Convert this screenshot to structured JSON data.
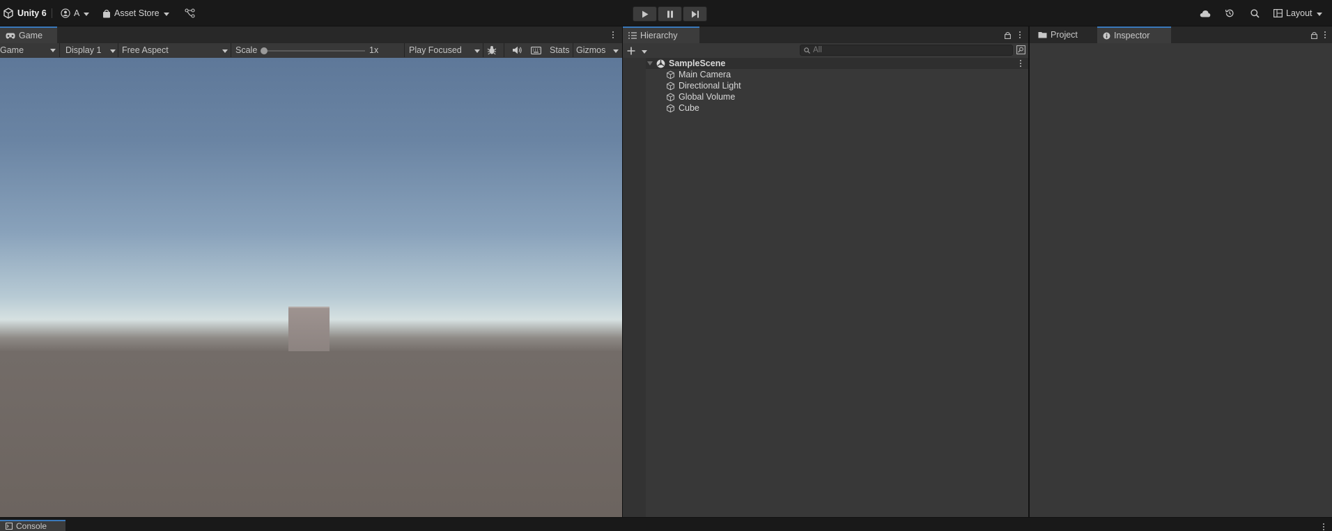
{
  "toolbar": {
    "app_title": "Unity 6",
    "account_label": "A",
    "asset_store_label": "Asset Store",
    "layout_label": "Layout"
  },
  "game_panel": {
    "tab_label": "Game",
    "mode_dropdown": "Game",
    "display_dropdown": "Display 1",
    "aspect_dropdown": "Free Aspect",
    "scale_label": "Scale",
    "scale_value": "1x",
    "scale_fraction": 0.0,
    "play_mode_dropdown": "Play Focused",
    "stats_label": "Stats",
    "gizmos_label": "Gizmos"
  },
  "hierarchy": {
    "tab_label": "Hierarchy",
    "search_placeholder": "All",
    "scene_name": "SampleScene",
    "items": [
      {
        "label": "Main Camera"
      },
      {
        "label": "Directional Light"
      },
      {
        "label": "Global Volume"
      },
      {
        "label": "Cube"
      }
    ]
  },
  "inspector": {
    "project_tab_label": "Project",
    "inspector_tab_label": "Inspector"
  },
  "console": {
    "tab_label": "Console"
  },
  "colors": {
    "accent": "#3a79bb",
    "panel": "#383838",
    "toolbar": "#191919"
  }
}
